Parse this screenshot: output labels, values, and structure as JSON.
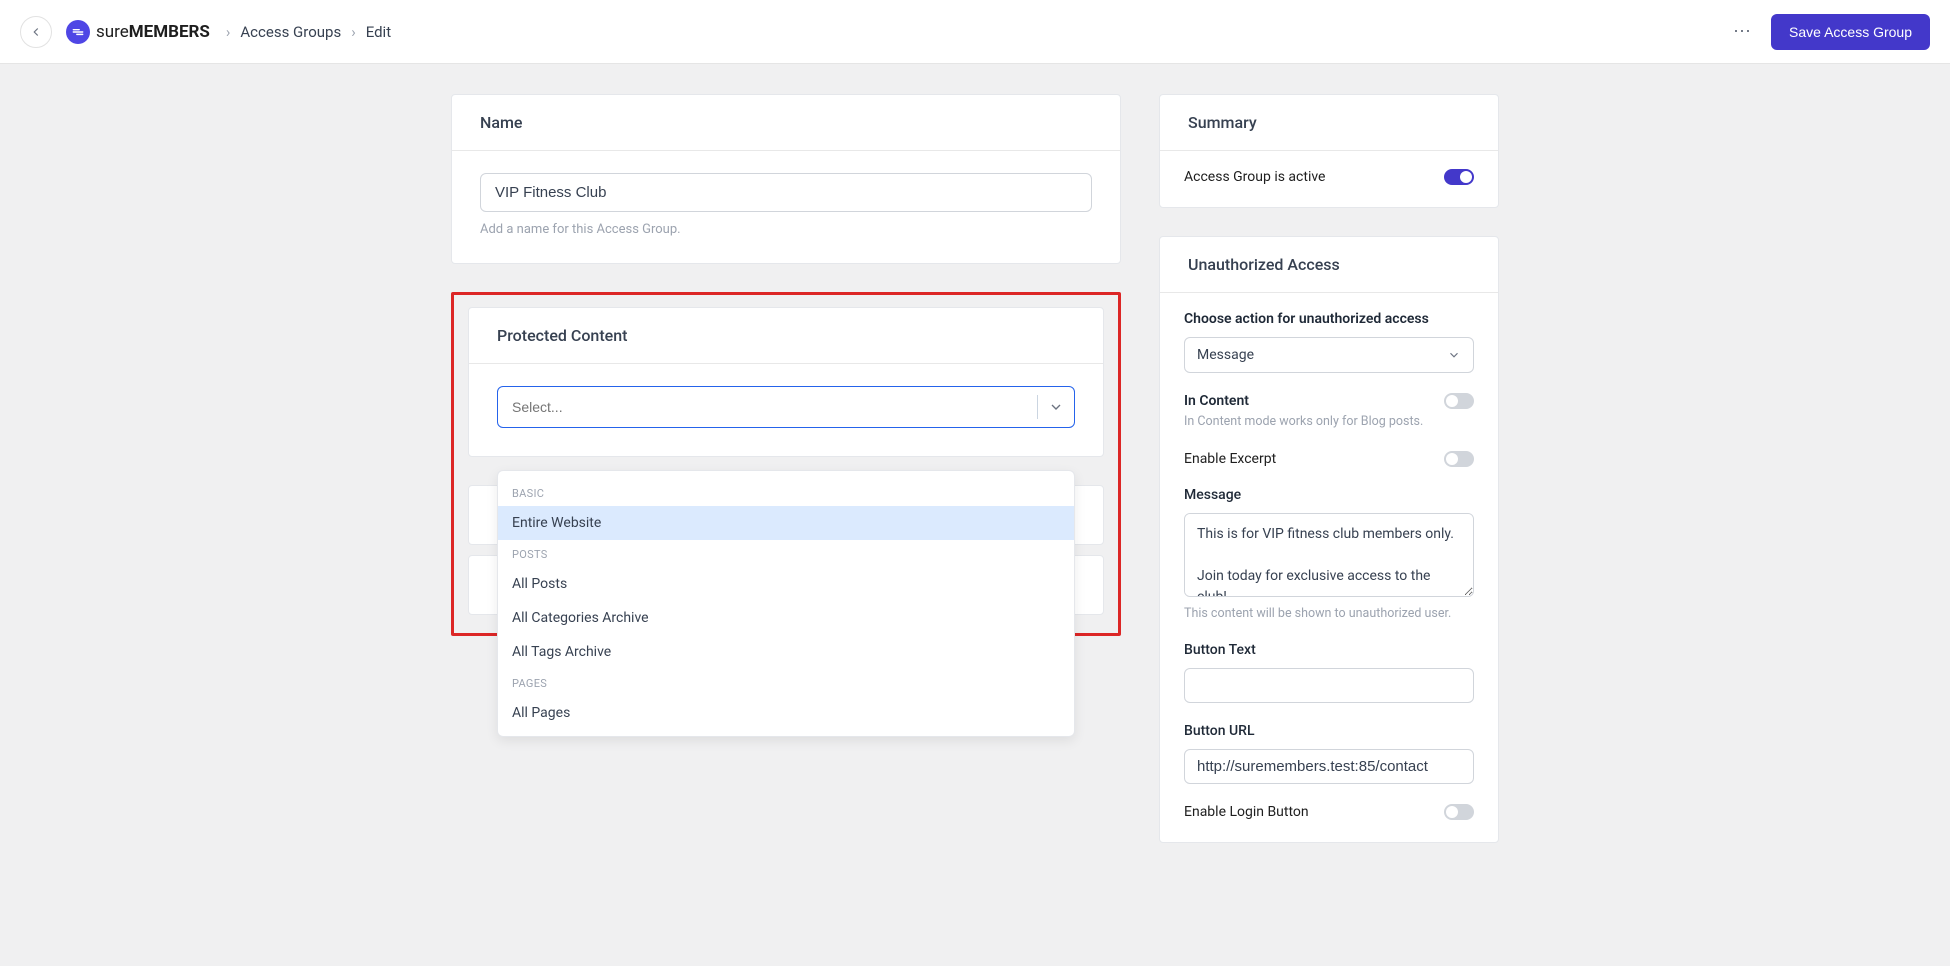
{
  "header": {
    "logo_light": "sure",
    "logo_bold": "MEMBERS",
    "breadcrumb": {
      "item1": "Access Groups",
      "item2": "Edit"
    },
    "save_label": "Save Access Group"
  },
  "name_card": {
    "title": "Name",
    "value": "VIP Fitness Club",
    "help": "Add a name for this Access Group."
  },
  "protected_card": {
    "title": "Protected Content",
    "placeholder": "Select...",
    "dropdown": {
      "group1_label": "BASIC",
      "group1_items": [
        "Entire Website"
      ],
      "group2_label": "POSTS",
      "group2_items": [
        "All Posts",
        "All Categories Archive",
        "All Tags Archive"
      ],
      "group3_label": "PAGES",
      "group3_items": [
        "All Pages"
      ]
    }
  },
  "summary": {
    "title": "Summary",
    "active_label": "Access Group is active"
  },
  "unauth": {
    "title": "Unauthorized Access",
    "action_label": "Choose action for unauthorized access",
    "action_value": "Message",
    "in_content_label": "In Content",
    "in_content_help": "In Content mode works only for Blog posts.",
    "excerpt_label": "Enable Excerpt",
    "message_label": "Message",
    "message_value": "This is for VIP fitness club members only.\n\nJoin today for exclusive access to the club!",
    "message_help": "This content will be shown to unauthorized user.",
    "button_text_label": "Button Text",
    "button_text_value": "",
    "button_url_label": "Button URL",
    "button_url_value": "http://suremembers.test:85/contact",
    "login_btn_label": "Enable Login Button"
  }
}
